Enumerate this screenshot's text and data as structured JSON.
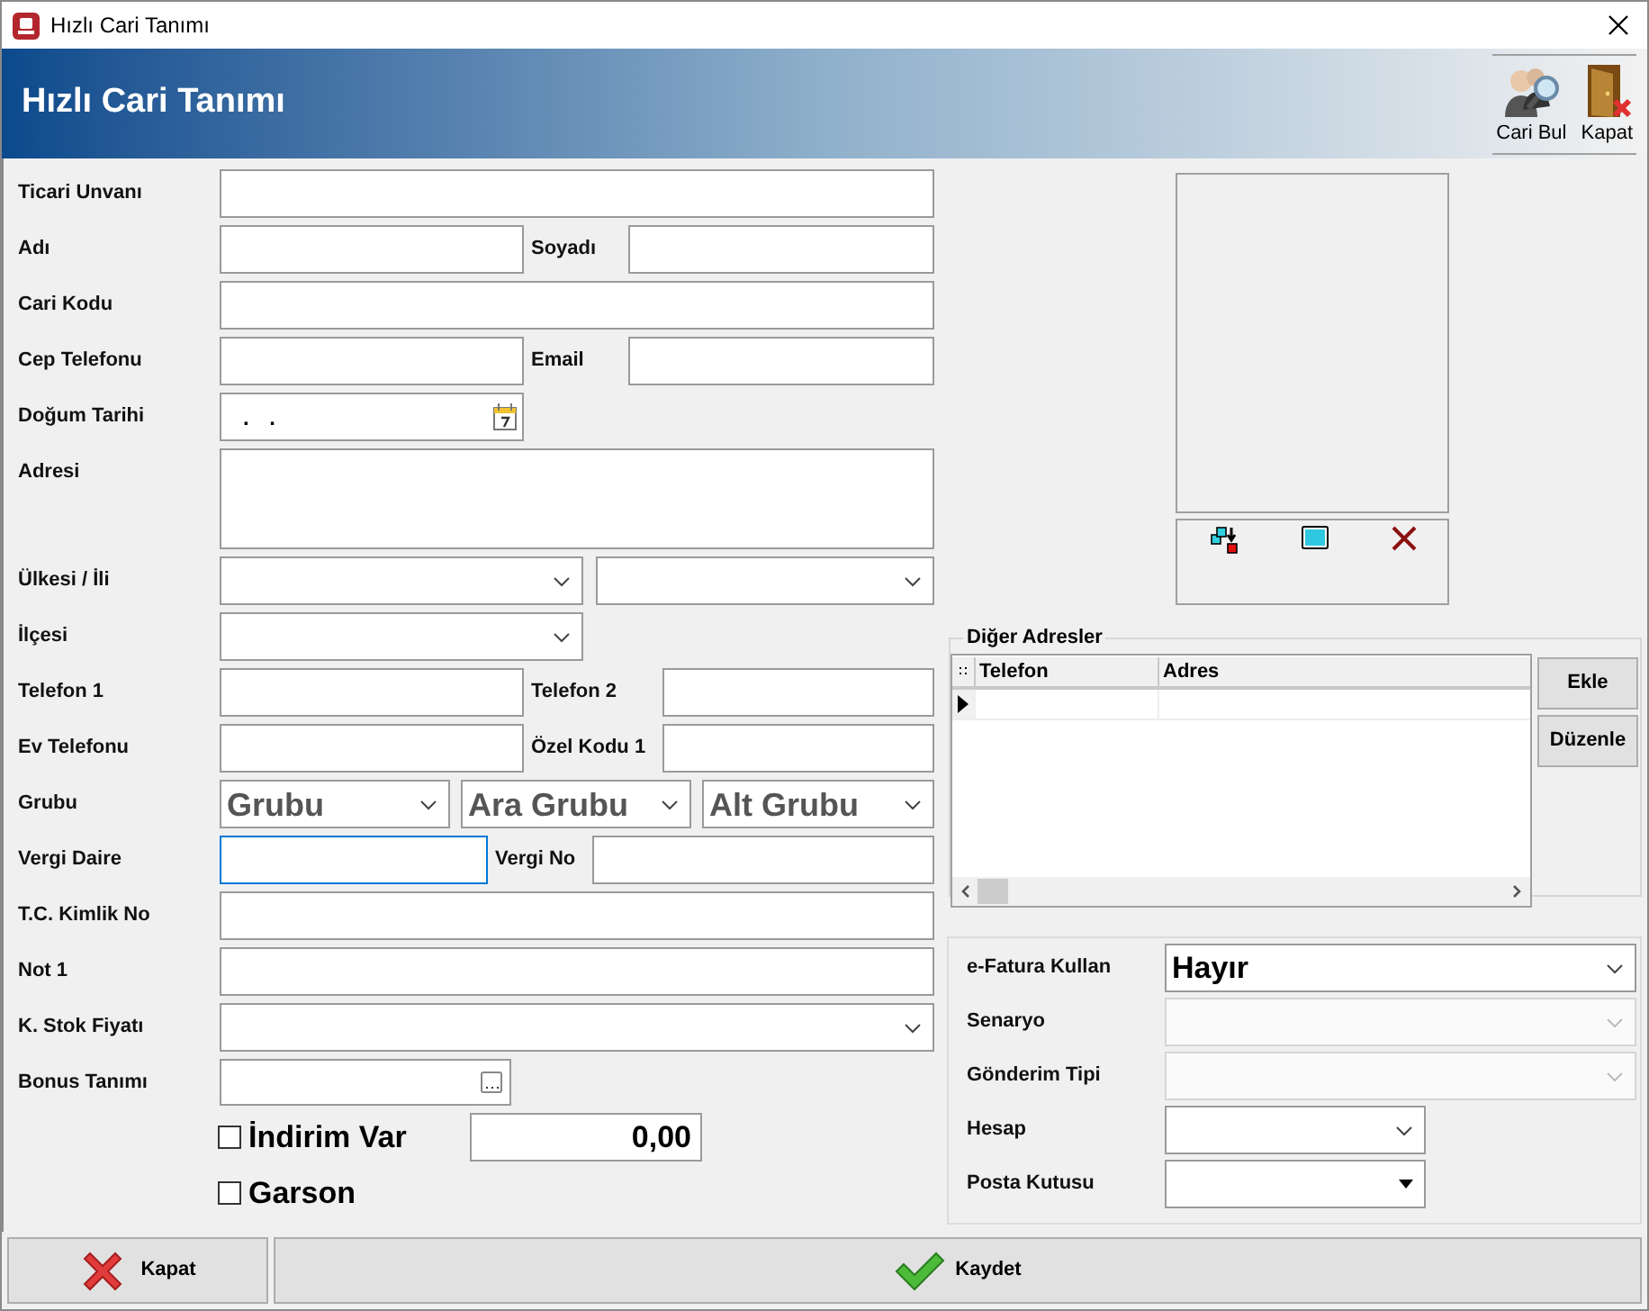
{
  "window": {
    "title": "Hızlı Cari Tanımı"
  },
  "banner": {
    "title": "Hızlı Cari Tanımı",
    "tools": [
      {
        "label": "Cari Bul",
        "kind": "find"
      },
      {
        "label": "Kapat",
        "kind": "close"
      }
    ]
  },
  "form": {
    "ticari_unvani": {
      "label": "Ticari Unvanı"
    },
    "adi": {
      "label": "Adı"
    },
    "soyadi": {
      "label": "Soyadı"
    },
    "cari_kodu": {
      "label": "Cari Kodu"
    },
    "cep_telefonu": {
      "label": "Cep Telefonu"
    },
    "email": {
      "label": "Email"
    },
    "dogum_tarihi": {
      "label": "Doğum Tarihi",
      "value": ". ."
    },
    "adresi": {
      "label": "Adresi"
    },
    "ulkesi_ili": {
      "label": "Ülkesi / İli"
    },
    "ilcesi": {
      "label": "İlçesi"
    },
    "telefon_1": {
      "label": "Telefon 1"
    },
    "telefon_2": {
      "label": "Telefon 2"
    },
    "ev_telefonu": {
      "label": "Ev Telefonu"
    },
    "ozel_kodu_1": {
      "label": "Özel Kodu 1"
    },
    "grubu": {
      "label": "Grubu",
      "combos": [
        {
          "placeholder": "Grubu"
        },
        {
          "placeholder": "Ara Grubu"
        },
        {
          "placeholder": "Alt Grubu"
        }
      ]
    },
    "vergi_daire": {
      "label": "Vergi Daire",
      "focused": true
    },
    "vergi_no": {
      "label": "Vergi No"
    },
    "tc_kimlik_no": {
      "label": "T.C. Kimlik No"
    },
    "not_1": {
      "label": "Not 1"
    },
    "k_stok_fiyati": {
      "label": "K. Stok Fiyatı"
    },
    "bonus_tanimi": {
      "label": "Bonus Tanımı"
    },
    "indirim_var": {
      "label": "İndirim Var",
      "checked": false,
      "amount": "0,00"
    },
    "garson": {
      "label": "Garson",
      "checked": false
    }
  },
  "other_addresses": {
    "title": "Diğer Adresler",
    "columns": [
      "Telefon",
      "Adres"
    ],
    "buttons": [
      "Ekle",
      "Düzenle"
    ]
  },
  "efatura": [
    {
      "label": "e-Fatura Kullan",
      "value": "Hayır",
      "disabled": false,
      "kind": "wide"
    },
    {
      "label": "Senaryo",
      "disabled": true,
      "kind": "wide"
    },
    {
      "label": "Gönderim Tipi",
      "disabled": true,
      "kind": "wide"
    },
    {
      "label": "Hesap",
      "disabled": false,
      "kind": "short"
    },
    {
      "label": "Posta Kutusu",
      "disabled": false,
      "kind": "short_solid"
    }
  ],
  "footer": {
    "close": "Kapat",
    "save": "Kaydet"
  }
}
